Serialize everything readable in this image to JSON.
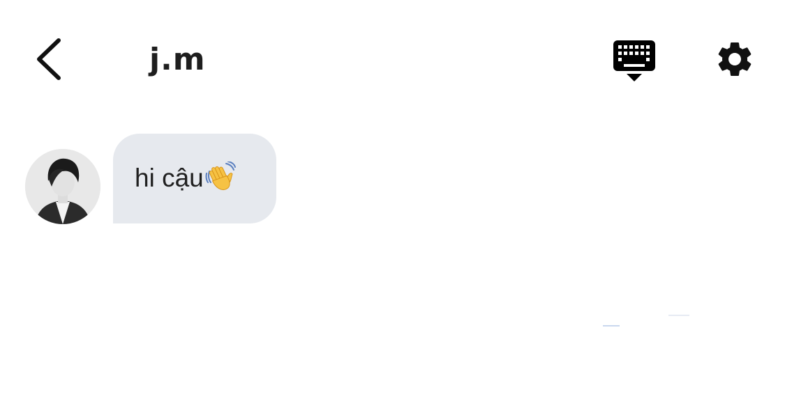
{
  "header": {
    "title": "j.m",
    "back_icon": "chevron-left-icon",
    "keyboard_icon": "keyboard-hide-icon",
    "settings_icon": "gear-icon"
  },
  "conversation": {
    "messages": [
      {
        "sender": "j.m",
        "text": "hi cậu",
        "emoji": "waving-hand-icon",
        "bubble_color": "#e6e9ee"
      }
    ]
  },
  "colors": {
    "background": "#ffffff",
    "text": "#1e1e1e",
    "bubble": "#e6e9ee",
    "icon": "#111111"
  }
}
